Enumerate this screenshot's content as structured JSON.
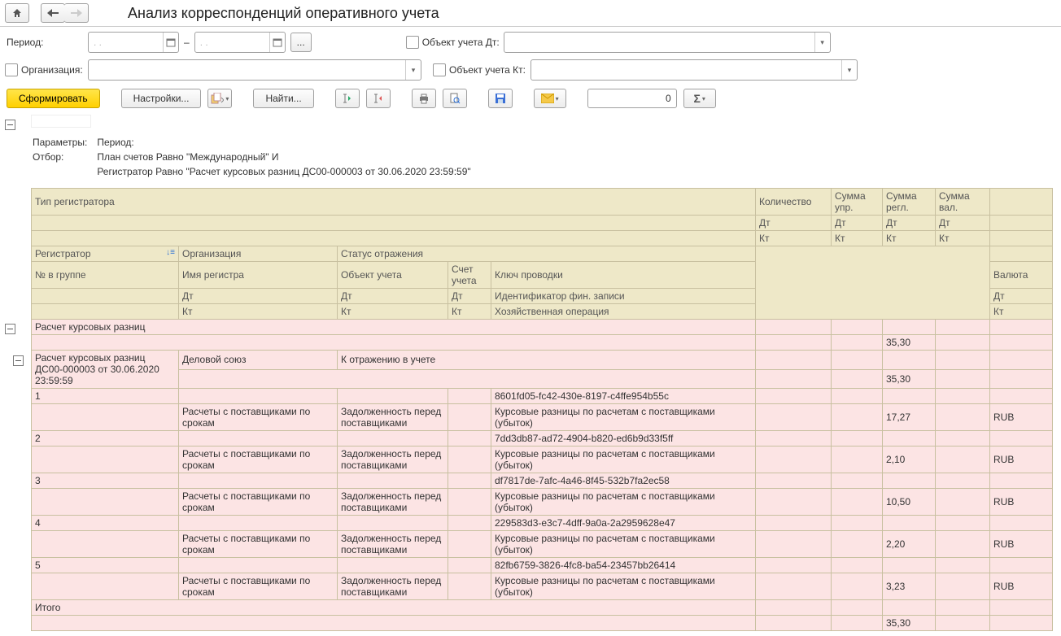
{
  "title": "Анализ корреспонденций оперативного учета",
  "filters": {
    "period_lbl": "Период:",
    "date_ph": "  .    .    ",
    "dash": "–",
    "dots": "...",
    "org_lbl": "Организация:",
    "obj_dt_lbl": "Объект учета Дт:",
    "obj_kt_lbl": "Объект учета Кт:"
  },
  "toolbar": {
    "form": "Сформировать",
    "settings": "Настройки...",
    "find": "Найти...",
    "num": "0"
  },
  "params": {
    "p_lbl": "Параметры:",
    "p_val": "Период:",
    "o_lbl": "Отбор:",
    "o_l1": "План счетов Равно \"Международный\" И",
    "o_l2": "Регистратор Равно \"Расчет курсовых разниц ДС00-000003 от 30.06.2020 23:59:59\""
  },
  "hdr": {
    "type": "Тип регистратора",
    "qty": "Количество",
    "sum_upr": "Сумма упр.",
    "sum_reg": "Сумма регл.",
    "sum_val": "Сумма вал.",
    "dt": "Дт",
    "kt": "Кт",
    "reg": "Регистратор",
    "org": "Организация",
    "status": "Статус отражения",
    "grpnum": "№ в группе",
    "regname": "Имя регистра",
    "object": "Объект учета",
    "acct": "Счет учета",
    "key": "Ключ проводки",
    "currency": "Валюта",
    "finid": "Идентификатор фин. записи",
    "oper": "Хозяйственная операция",
    "total": "Итого"
  },
  "group": {
    "title": "Расчет курсовых разниц",
    "doc": "Расчет курсовых разниц ДС00-000003 от 30.06.2020 23:59:59",
    "org": "Деловой союз",
    "status": "К отражению в учете",
    "sum": "35,30",
    "regname": "Расчеты с поставщиками по срокам",
    "obj": "Задолженность перед поставщиками",
    "oper": "Курсовые разницы по расчетам с поставщиками (убыток)",
    "cur": "RUB"
  },
  "rows": [
    {
      "n": "1",
      "id": "8601fd05-fc42-430e-8197-c4ffe954b55c",
      "sum": "17,27"
    },
    {
      "n": "2",
      "id": "7dd3db87-ad72-4904-b820-ed6b9d33f5ff",
      "sum": "2,10"
    },
    {
      "n": "3",
      "id": "df7817de-7afc-4a46-8f45-532b7fa2ec58",
      "sum": "10,50"
    },
    {
      "n": "4",
      "id": "229583d3-e3c7-4dff-9a0a-2a2959628e47",
      "sum": "2,20"
    },
    {
      "n": "5",
      "id": "82fb6759-3826-4fc8-ba54-23457bb26414",
      "sum": "3,23"
    }
  ]
}
